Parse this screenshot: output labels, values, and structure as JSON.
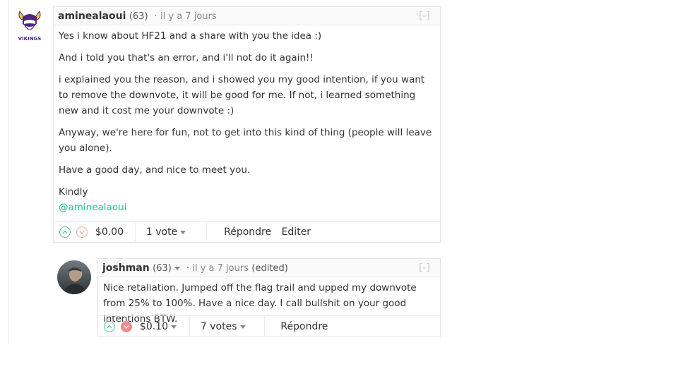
{
  "comment1": {
    "author": "aminealaoui",
    "reputation": "(63)",
    "dot": "·",
    "time": "il y a 7 jours",
    "collapse_label": "[-]",
    "paragraphs": [
      "Yes i know about HF21 and a share with you the idea :)",
      "And i told you that's an error, and i'll not do it again!!",
      "i explained you the reason, and i showed you my good intention, if you want to remove the downvote, it will be good for me. If not, i learned something new and it cost me your downvote :)",
      "Anyway, we're here for fun, not to get into this kind of thing (people will leave you alone).",
      "Have a good day, and nice to meet you."
    ],
    "signoff": "Kindly",
    "mention": "@aminealaoui",
    "payout": "$0.00",
    "votes": "1 vote",
    "reply_label": "Répondre",
    "edit_label": "Editer"
  },
  "comment2": {
    "author": "joshman",
    "reputation": "(63)",
    "dot": "·",
    "time": "il y a 7 jours",
    "edited": "(edited)",
    "collapse_label": "[-]",
    "body": "Nice retaliation. Jumped off the flag trail and upped my downvote from 25% to 100%. Have a nice day. I call bullshit on your good intentions BTW.",
    "payout": "$0.10",
    "votes": "7 votes",
    "reply_label": "Répondre"
  },
  "colors": {
    "upvote": "#52c38d",
    "downvote": "#f28b8b",
    "link": "#1fbf8f",
    "logo_purple": "#4f2683",
    "logo_gold": "#ffc62f"
  }
}
